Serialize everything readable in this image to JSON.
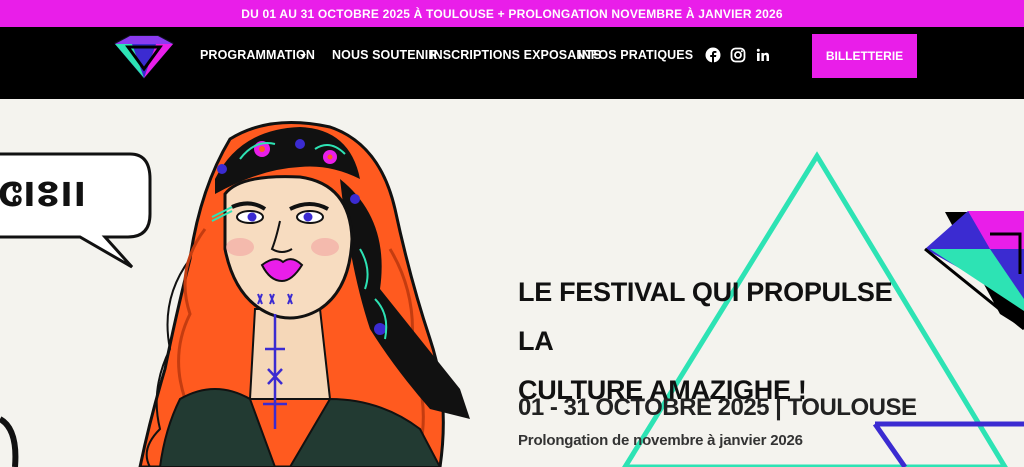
{
  "announcement": {
    "text": "DU 01 AU 31 OCTOBRE 2025 À TOULOUSE + PROLONGATION NOVEMBRE À JANVIER 2026"
  },
  "nav": {
    "logo_icon": "diamond-logo-icon",
    "items": [
      {
        "label": "PROGRAMMATION",
        "has_dropdown": true
      },
      {
        "label": "NOUS SOUTENIR"
      },
      {
        "label": "INSCRIPTIONS EXPOSANTS"
      },
      {
        "label": "INFOS PRATIQUES"
      }
    ],
    "social": [
      "facebook-icon",
      "instagram-icon",
      "linkedin-icon"
    ],
    "ticket_button": "BILLETTERIE"
  },
  "hero": {
    "headline_line1": "LE FESTIVAL QUI PROPULSE LA",
    "headline_line2": "CULTURE AMAZIGHE !",
    "dates": "01 - 31 OCTOBRE 2025 | TOULOUSE",
    "extension": "Prolongation de novembre à janvier 2026",
    "bubble_text": "ⵛⵏⵓⵏⵏ"
  },
  "colors": {
    "accent": "#e91ee9",
    "nav_bg": "#000000",
    "hero_bg": "#f4f3ee",
    "triangle": "#2de3b4",
    "hair": "#ff5a1f"
  }
}
